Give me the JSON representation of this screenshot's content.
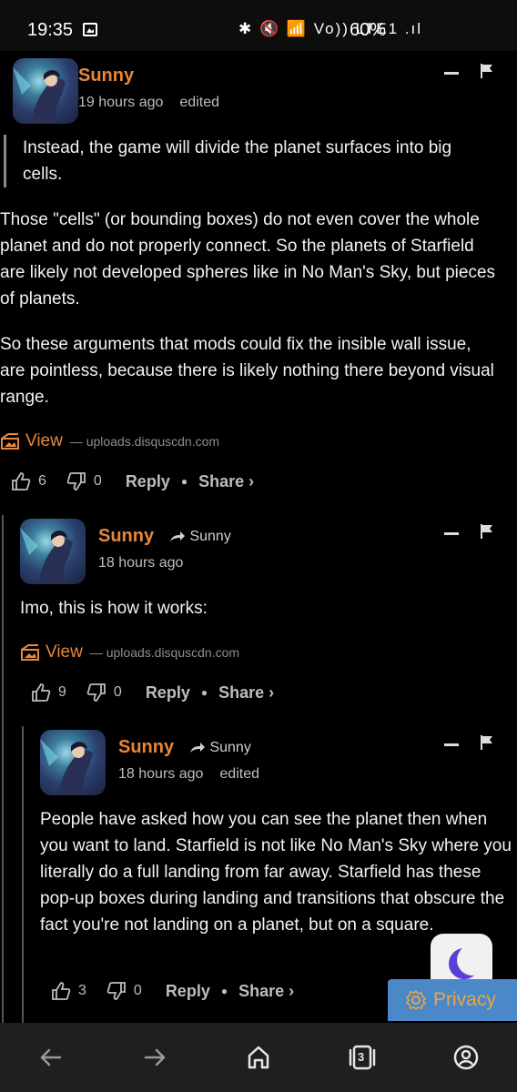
{
  "status_bar": {
    "time": "19:35",
    "icons_text": "✱ 🔇 📶 Vo)) LTE1 .ıl",
    "battery": "60%"
  },
  "comments": [
    {
      "author": "Sunny",
      "time": "19 hours ago",
      "edited": "edited",
      "quote": "Instead, the game will divide the planet surfaces into big cells.",
      "paragraphs": [
        "Those \"cells\" (or bounding boxes) do not even cover the whole planet and do not properly connect. So the planets of Starfield are likely not developed spheres like in No Man's Sky, but pieces of planets.",
        "So these arguments that mods could fix the insible wall issue, are pointless, because there is likely nothing there beyond visual range."
      ],
      "view_label": "View",
      "view_domain": "— uploads.disquscdn.com",
      "upvotes": "6",
      "downvotes": "0",
      "reply": "Reply",
      "share": "Share ›"
    },
    {
      "author": "Sunny",
      "reply_to": "Sunny",
      "time": "18 hours ago",
      "text": "Imo, this is how it works:",
      "view_label": "View",
      "view_domain": "— uploads.disquscdn.com",
      "upvotes": "9",
      "downvotes": "0",
      "reply": "Reply",
      "share": "Share ›"
    },
    {
      "author": "Sunny",
      "reply_to": "Sunny",
      "time": "18 hours ago",
      "edited": "edited",
      "text": "People have asked how you can see the planet then when you want to land. Starfield is not like No Man's Sky where you literally do a full landing from far away. Starfield has these pop-up boxes during landing and transitions that obscure the fact you're not landing on a planet, but on a square.",
      "upvotes": "3",
      "downvotes": "0",
      "reply": "Reply",
      "share": "Share ›"
    }
  ],
  "privacy_label": "Privacy",
  "navbar": {
    "tabs_count": "3"
  },
  "colors": {
    "accent": "#e8873a",
    "background": "#000000",
    "privacy_bg": "#4a88c7",
    "moon": "#5b3fd8"
  }
}
